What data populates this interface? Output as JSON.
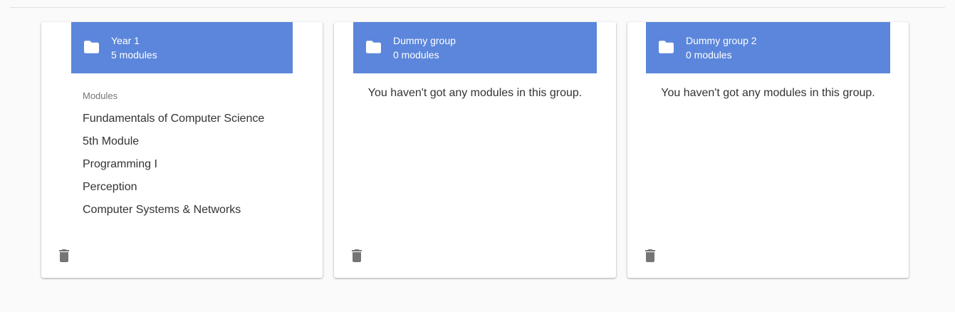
{
  "colors": {
    "header_bg": "#5b86db",
    "header_text": "#ffffff",
    "card_bg": "#ffffff",
    "page_bg": "#fafafa",
    "icon_gray": "#757575"
  },
  "groups": [
    {
      "title": "Year 1",
      "count_label": "5 modules",
      "icon": "folder-icon",
      "list_subheader": "Modules",
      "modules": [
        "Fundamentals of Computer Science",
        "5th Module",
        "Programming I",
        "Perception",
        "Computer Systems & Networks"
      ],
      "delete_icon": "trash-icon"
    },
    {
      "title": "Dummy group",
      "count_label": "0 modules",
      "icon": "folder-icon",
      "empty_message": "You haven't got any modules in this group.",
      "delete_icon": "trash-icon"
    },
    {
      "title": "Dummy group 2",
      "count_label": "0 modules",
      "icon": "folder-icon",
      "empty_message": "You haven't got any modules in this group.",
      "delete_icon": "trash-icon"
    }
  ]
}
